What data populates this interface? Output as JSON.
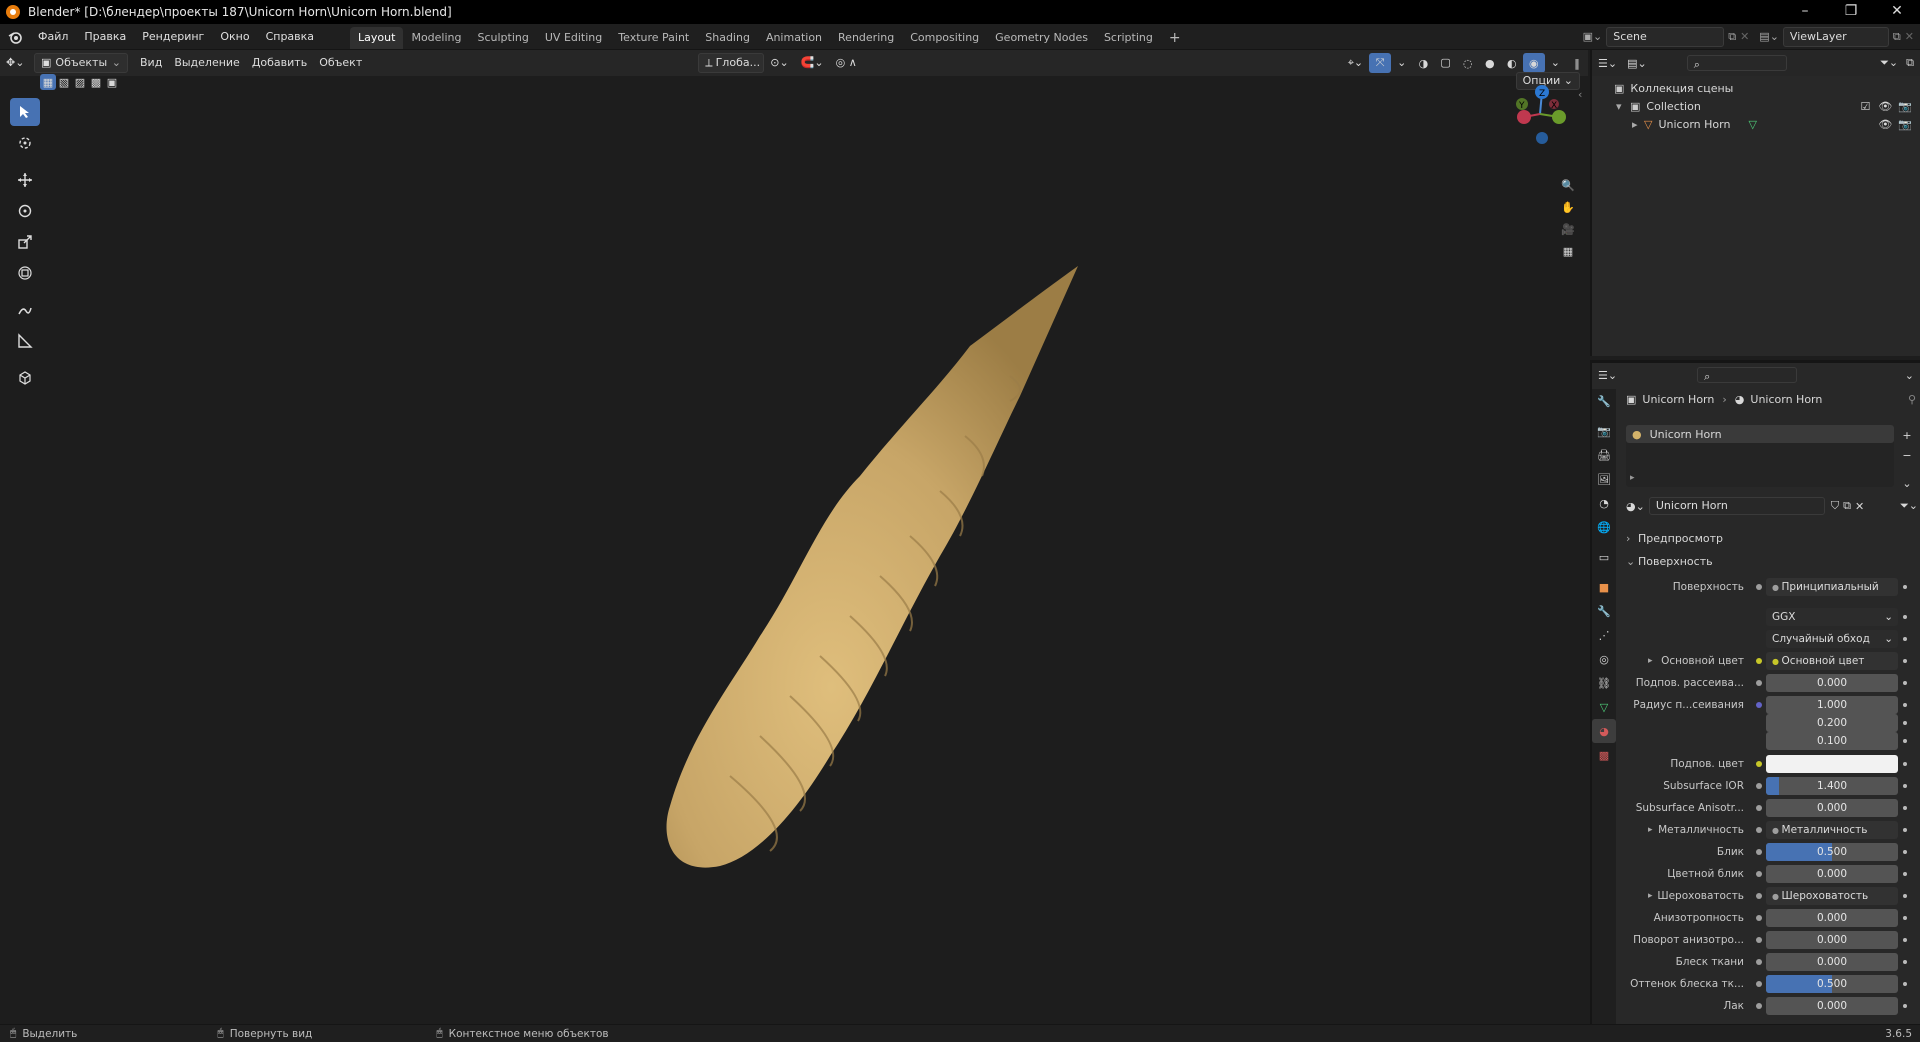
{
  "titlebar": {
    "title": "Blender* [D:\\блендер\\проекты 187\\Unicorn Horn\\Unicorn Horn.blend]"
  },
  "menu": [
    "Файл",
    "Правка",
    "Рендеринг",
    "Окно",
    "Справка"
  ],
  "workspaces": [
    "Layout",
    "Modeling",
    "Sculpting",
    "UV Editing",
    "Texture Paint",
    "Shading",
    "Animation",
    "Rendering",
    "Compositing",
    "Geometry Nodes",
    "Scripting"
  ],
  "active_workspace": "Layout",
  "scene": {
    "name": "Scene",
    "view_layer": "ViewLayer"
  },
  "viewport_header": {
    "mode": "Объекты",
    "items": [
      "Вид",
      "Выделение",
      "Добавить",
      "Объект"
    ],
    "transform": "Глоба...",
    "options": "Опции"
  },
  "outliner": {
    "root": "Коллекция сцены",
    "collection": "Collection",
    "object": "Unicorn Horn"
  },
  "properties": {
    "breadcrumb": [
      "Unicorn Horn",
      "Unicorn Horn"
    ],
    "slot": "Unicorn Horn",
    "material": "Unicorn Horn",
    "preview": "Предпросмотр",
    "surface_panel": "Поверхность",
    "rows": [
      {
        "label": "Поверхность",
        "value": "Принципиальный BSDF",
        "kind": "link",
        "dot": "gray"
      },
      {
        "label": "",
        "value": "GGX",
        "kind": "enum"
      },
      {
        "label": "",
        "value": "Случайный обход",
        "kind": "enum"
      },
      {
        "label": "Основной цвет",
        "value": "Основной цвет",
        "kind": "link",
        "dot": "yellow",
        "arrow": true
      },
      {
        "label": "Подпов. рассеива...",
        "value": "0.000",
        "kind": "num",
        "dot": "gray"
      },
      {
        "label": "Радиус п...сеивания",
        "value": "1.000",
        "kind": "num",
        "dot": "blue"
      },
      {
        "label": "",
        "value": "0.200",
        "kind": "num"
      },
      {
        "label": "",
        "value": "0.100",
        "kind": "num"
      },
      {
        "label": "Подпов. цвет",
        "value": "",
        "kind": "color",
        "dot": "yellow"
      },
      {
        "label": "Subsurface IOR",
        "value": "1.400",
        "kind": "num",
        "dot": "gray",
        "fill": 0.1
      },
      {
        "label": "Subsurface Anisotr...",
        "value": "0.000",
        "kind": "num",
        "dot": "gray"
      },
      {
        "label": "Металличность",
        "value": "Металличность",
        "kind": "link",
        "dot": "gray",
        "arrow": true
      },
      {
        "label": "Блик",
        "value": "0.500",
        "kind": "num",
        "dot": "gray",
        "fill": 0.5
      },
      {
        "label": "Цветной блик",
        "value": "0.000",
        "kind": "num",
        "dot": "gray"
      },
      {
        "label": "Шероховатость",
        "value": "Шероховатость",
        "kind": "link",
        "dot": "gray",
        "arrow": true
      },
      {
        "label": "Анизотропность",
        "value": "0.000",
        "kind": "num",
        "dot": "gray"
      },
      {
        "label": "Поворот анизотро...",
        "value": "0.000",
        "kind": "num",
        "dot": "gray"
      },
      {
        "label": "Блеск ткани",
        "value": "0.000",
        "kind": "num",
        "dot": "gray"
      },
      {
        "label": "Оттенок блеска тк...",
        "value": "0.500",
        "kind": "num",
        "dot": "gray",
        "fill": 0.5
      },
      {
        "label": "Лак",
        "value": "0.000",
        "kind": "num",
        "dot": "gray"
      }
    ]
  },
  "status": {
    "left": "Выделить",
    "middle": "Повернуть вид",
    "right": "Контекстное меню объектов",
    "version": "3.6.5"
  },
  "colors": {
    "accent": "#4772b3",
    "horn": "#c7a567",
    "brand": "#e87d0d"
  }
}
